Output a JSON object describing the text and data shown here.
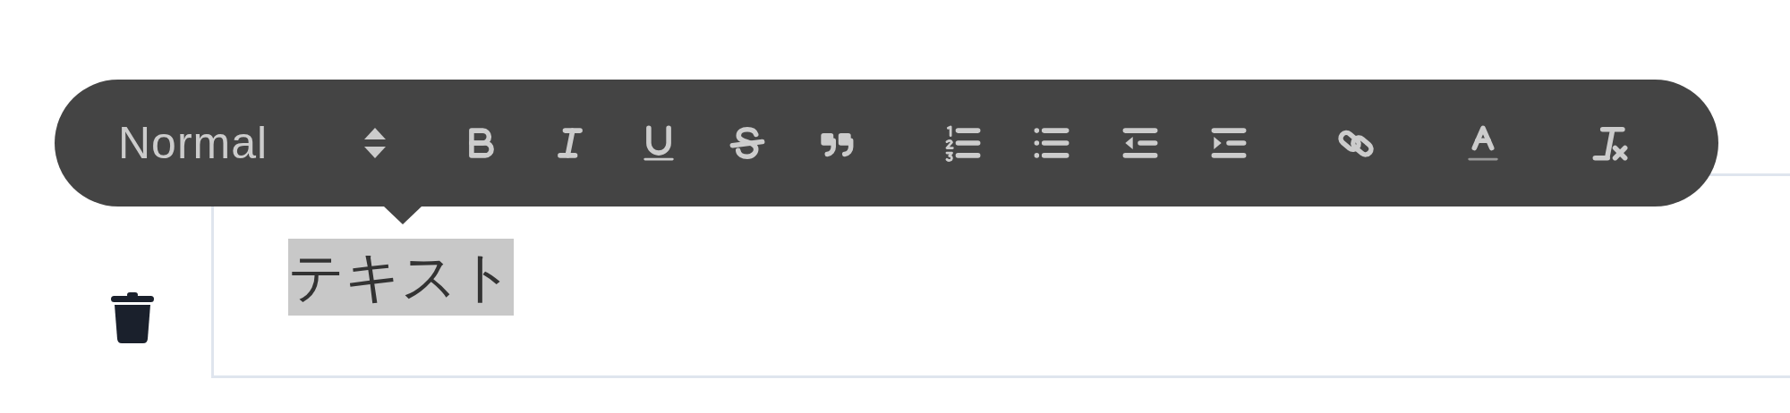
{
  "toolbar": {
    "format_select": {
      "value": "Normal"
    },
    "groups": [
      [
        {
          "kind": "bold"
        },
        {
          "kind": "italic"
        },
        {
          "kind": "underline"
        },
        {
          "kind": "strike"
        },
        {
          "kind": "blockquote"
        }
      ],
      [
        {
          "kind": "ordered-list"
        },
        {
          "kind": "bullet-list"
        },
        {
          "kind": "outdent"
        },
        {
          "kind": "indent"
        }
      ],
      [
        {
          "kind": "link"
        }
      ],
      [
        {
          "kind": "color"
        }
      ],
      [
        {
          "kind": "clean"
        }
      ]
    ]
  },
  "editor": {
    "text": "テキスト",
    "highlighted": true
  }
}
